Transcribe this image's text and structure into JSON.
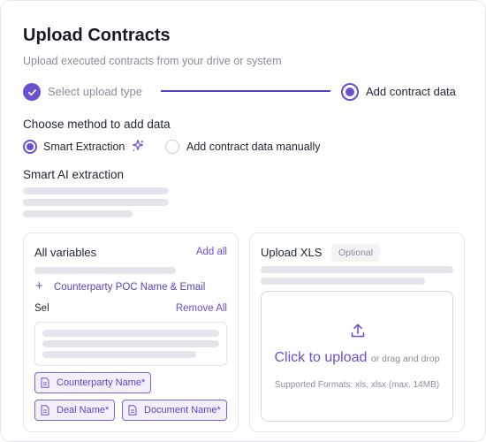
{
  "header": {
    "title": "Upload Contracts",
    "subtitle": "Upload executed contracts from your drive or system"
  },
  "stepper": {
    "steps": [
      {
        "label": "Select upload type",
        "state": "completed"
      },
      {
        "label": "Add contract data",
        "state": "active"
      }
    ]
  },
  "method": {
    "heading": "Choose method to add data",
    "options": [
      {
        "label": "Smart Extraction",
        "selected": true,
        "icon": "sparkle-icon"
      },
      {
        "label": "Add contract data manually",
        "selected": false
      }
    ]
  },
  "smart_ai": {
    "heading": "Smart AI extraction"
  },
  "variables_panel": {
    "title": "All variables",
    "add_all": "Add all",
    "add_item": "Counterparty POC Name & Email",
    "selected_label": "Sel",
    "remove_all": "Remove All",
    "tags": [
      "Counterparty Name*",
      "Deal Name*",
      "Document Name*"
    ]
  },
  "upload_panel": {
    "title": "Upload XLS",
    "badge": "Optional",
    "click_text": "Click to upload",
    "drag_text": "or drag and drop",
    "formats": "Supported Formats: xls, xlsx (max. 14MB)"
  },
  "colors": {
    "accent": "#6b4fd3",
    "skeleton": "#e4e5ea",
    "tag_bg": "#f3f0fc",
    "muted_text": "#8a8d98"
  }
}
